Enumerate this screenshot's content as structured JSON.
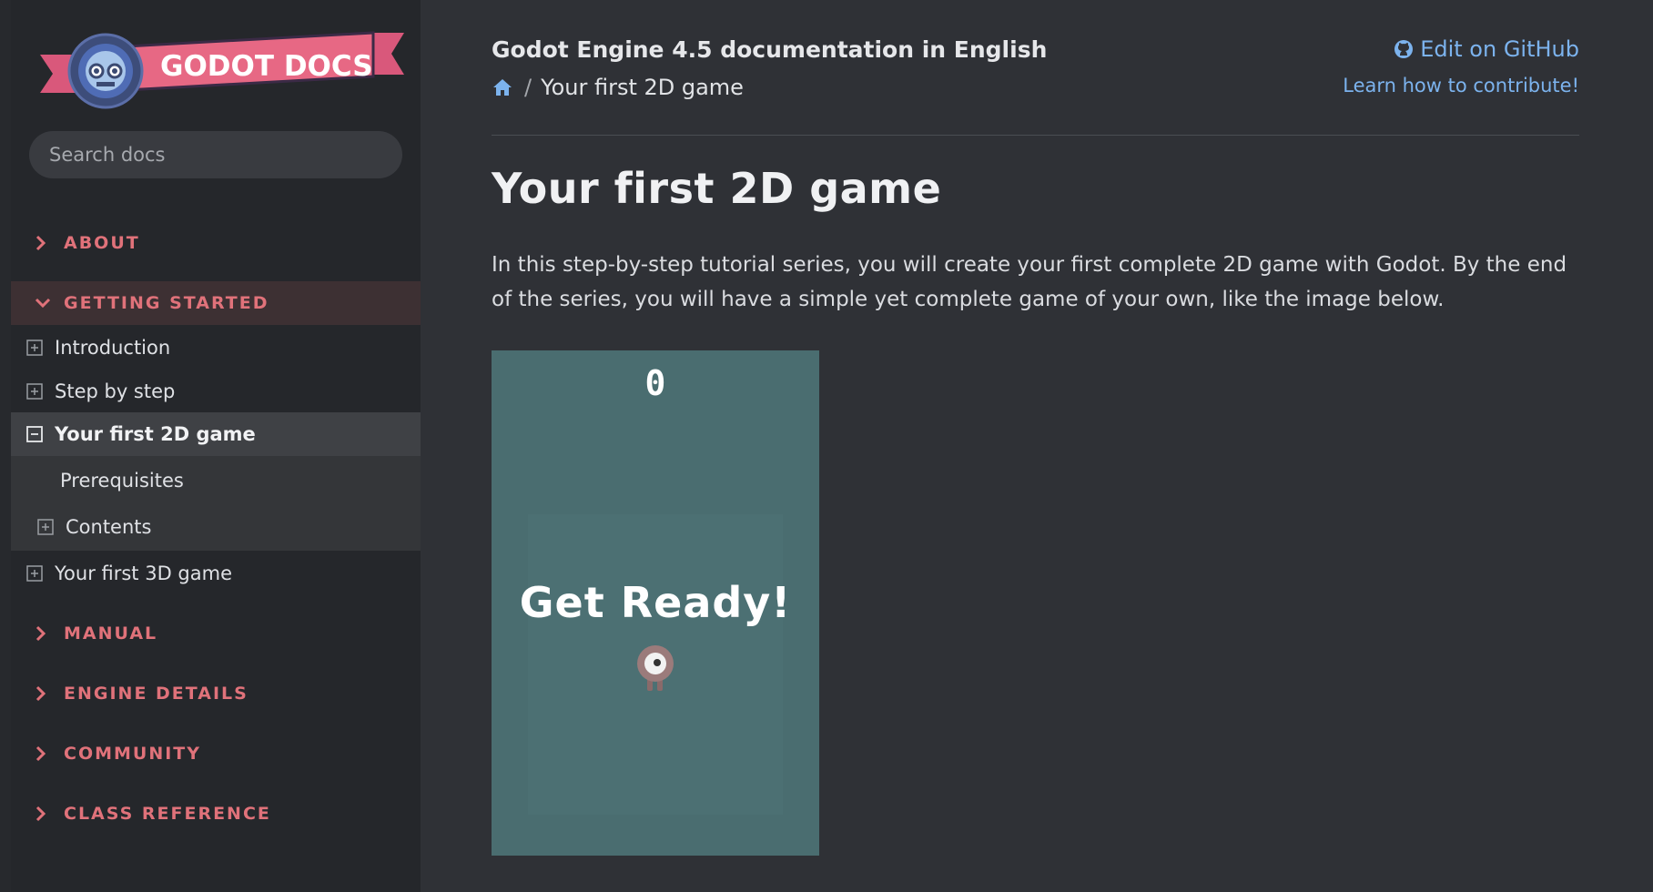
{
  "sidebar": {
    "logo_text": "GODOT DOCS",
    "search": {
      "placeholder": "Search docs"
    },
    "sections": [
      {
        "label": "ABOUT",
        "state": "collapsed"
      },
      {
        "label": "GETTING STARTED",
        "state": "expanded"
      },
      {
        "label": "MANUAL",
        "state": "collapsed"
      },
      {
        "label": "ENGINE DETAILS",
        "state": "collapsed"
      },
      {
        "label": "COMMUNITY",
        "state": "collapsed"
      },
      {
        "label": "CLASS REFERENCE",
        "state": "collapsed"
      }
    ],
    "getting_started_items": [
      {
        "label": "Introduction",
        "icon": "plus-box-icon"
      },
      {
        "label": "Step by step",
        "icon": "plus-box-icon"
      },
      {
        "label": "Your first 2D game",
        "icon": "minus-box-icon",
        "current": true
      },
      {
        "label": "Your first 3D game",
        "icon": "plus-box-icon"
      }
    ],
    "current_subitems": [
      {
        "label": "Prerequisites"
      },
      {
        "label": "Contents",
        "icon": "plus-box-icon"
      }
    ]
  },
  "header": {
    "doc_title": "Godot Engine 4.5 documentation in English",
    "breadcrumb": {
      "home_icon": "home-icon",
      "separator": "/",
      "current": "Your first 2D game"
    },
    "edit_link": "Edit on GitHub",
    "contribute_link": "Learn how to contribute!"
  },
  "content": {
    "title": "Your first 2D game",
    "intro": "In this step-by-step tutorial series, you will create your first complete 2D game with Godot. By the end of the series, you will have a simple yet complete game of your own, like the image below.",
    "game_image": {
      "score": "0",
      "message": "Get Ready!"
    }
  },
  "colors": {
    "accent_caption": "#e0727a",
    "link": "#7cb3ee",
    "background": "#2f3136",
    "sidebar": "#25272b",
    "game_bg": "#4a6d70"
  }
}
